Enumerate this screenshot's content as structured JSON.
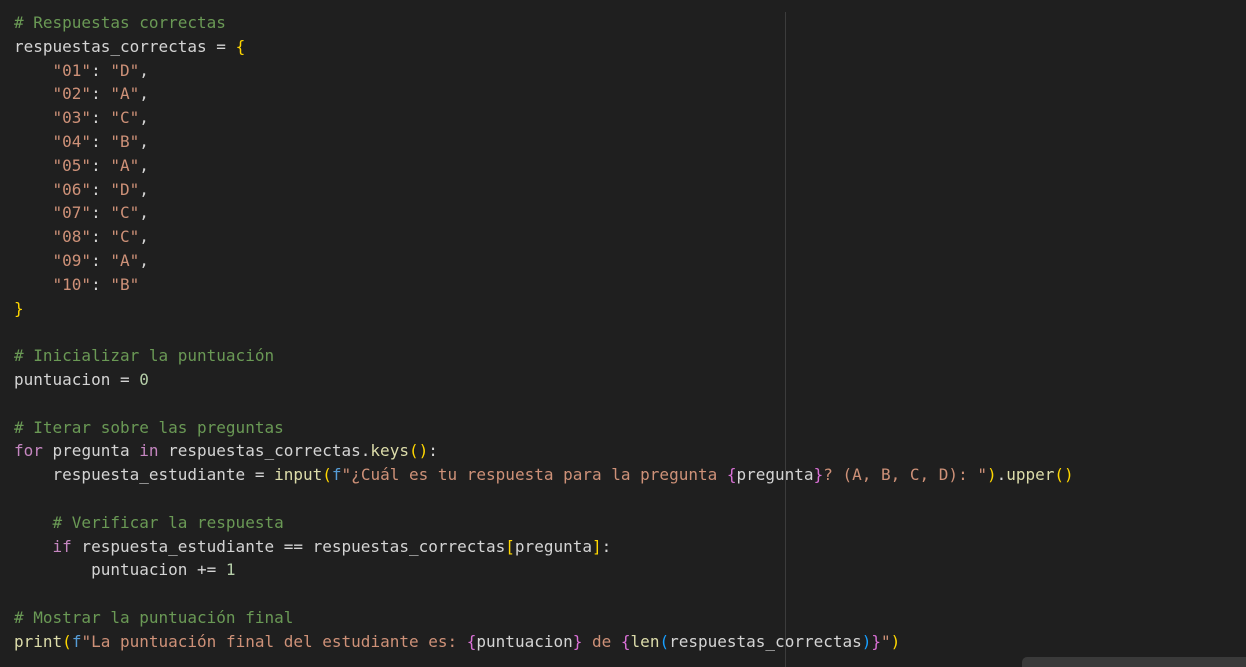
{
  "editor": {
    "lines": [
      [
        {
          "t": "# Respuestas correctas",
          "c": "comment"
        }
      ],
      [
        {
          "t": "respuestas_correctas",
          "c": "id"
        },
        {
          "t": " = ",
          "c": "op"
        },
        {
          "t": "{",
          "c": "b1"
        }
      ],
      [
        {
          "t": "    ",
          "c": "id"
        },
        {
          "t": "\"01\"",
          "c": "str"
        },
        {
          "t": ": ",
          "c": "op"
        },
        {
          "t": "\"D\"",
          "c": "str"
        },
        {
          "t": ",",
          "c": "op"
        }
      ],
      [
        {
          "t": "    ",
          "c": "id"
        },
        {
          "t": "\"02\"",
          "c": "str"
        },
        {
          "t": ": ",
          "c": "op"
        },
        {
          "t": "\"A\"",
          "c": "str"
        },
        {
          "t": ",",
          "c": "op"
        }
      ],
      [
        {
          "t": "    ",
          "c": "id"
        },
        {
          "t": "\"03\"",
          "c": "str"
        },
        {
          "t": ": ",
          "c": "op"
        },
        {
          "t": "\"C\"",
          "c": "str"
        },
        {
          "t": ",",
          "c": "op"
        }
      ],
      [
        {
          "t": "    ",
          "c": "id"
        },
        {
          "t": "\"04\"",
          "c": "str"
        },
        {
          "t": ": ",
          "c": "op"
        },
        {
          "t": "\"B\"",
          "c": "str"
        },
        {
          "t": ",",
          "c": "op"
        }
      ],
      [
        {
          "t": "    ",
          "c": "id"
        },
        {
          "t": "\"05\"",
          "c": "str"
        },
        {
          "t": ": ",
          "c": "op"
        },
        {
          "t": "\"A\"",
          "c": "str"
        },
        {
          "t": ",",
          "c": "op"
        }
      ],
      [
        {
          "t": "    ",
          "c": "id"
        },
        {
          "t": "\"06\"",
          "c": "str"
        },
        {
          "t": ": ",
          "c": "op"
        },
        {
          "t": "\"D\"",
          "c": "str"
        },
        {
          "t": ",",
          "c": "op"
        }
      ],
      [
        {
          "t": "    ",
          "c": "id"
        },
        {
          "t": "\"07\"",
          "c": "str"
        },
        {
          "t": ": ",
          "c": "op"
        },
        {
          "t": "\"C\"",
          "c": "str"
        },
        {
          "t": ",",
          "c": "op"
        }
      ],
      [
        {
          "t": "    ",
          "c": "id"
        },
        {
          "t": "\"08\"",
          "c": "str"
        },
        {
          "t": ": ",
          "c": "op"
        },
        {
          "t": "\"C\"",
          "c": "str"
        },
        {
          "t": ",",
          "c": "op"
        }
      ],
      [
        {
          "t": "    ",
          "c": "id"
        },
        {
          "t": "\"09\"",
          "c": "str"
        },
        {
          "t": ": ",
          "c": "op"
        },
        {
          "t": "\"A\"",
          "c": "str"
        },
        {
          "t": ",",
          "c": "op"
        }
      ],
      [
        {
          "t": "    ",
          "c": "id"
        },
        {
          "t": "\"10\"",
          "c": "str"
        },
        {
          "t": ": ",
          "c": "op"
        },
        {
          "t": "\"B\"",
          "c": "str"
        }
      ],
      [
        {
          "t": "}",
          "c": "b1"
        }
      ],
      [],
      [
        {
          "t": "# Inicializar la puntuación",
          "c": "comment"
        }
      ],
      [
        {
          "t": "puntuacion",
          "c": "id"
        },
        {
          "t": " = ",
          "c": "op"
        },
        {
          "t": "0",
          "c": "num"
        }
      ],
      [],
      [
        {
          "t": "# Iterar sobre las preguntas",
          "c": "comment"
        }
      ],
      [
        {
          "t": "for",
          "c": "ctrl"
        },
        {
          "t": " pregunta ",
          "c": "id"
        },
        {
          "t": "in",
          "c": "ctrl"
        },
        {
          "t": " respuestas_correctas.",
          "c": "id"
        },
        {
          "t": "keys",
          "c": "fn"
        },
        {
          "t": "()",
          "c": "b1"
        },
        {
          "t": ":",
          "c": "op"
        }
      ],
      [
        {
          "t": "    respuesta_estudiante",
          "c": "id"
        },
        {
          "t": " = ",
          "c": "op"
        },
        {
          "t": "input",
          "c": "fn"
        },
        {
          "t": "(",
          "c": "b1"
        },
        {
          "t": "f",
          "c": "kw"
        },
        {
          "t": "\"¿Cuál es tu respuesta para la pregunta ",
          "c": "str"
        },
        {
          "t": "{",
          "c": "b2"
        },
        {
          "t": "pregunta",
          "c": "id"
        },
        {
          "t": "}",
          "c": "b2"
        },
        {
          "t": "? (A, B, C, D): \"",
          "c": "str"
        },
        {
          "t": ")",
          "c": "b1"
        },
        {
          "t": ".",
          "c": "op"
        },
        {
          "t": "upper",
          "c": "fn"
        },
        {
          "t": "()",
          "c": "b1"
        }
      ],
      [],
      [
        {
          "t": "    ",
          "c": "id"
        },
        {
          "t": "# Verificar la respuesta",
          "c": "comment"
        }
      ],
      [
        {
          "t": "    ",
          "c": "id"
        },
        {
          "t": "if",
          "c": "ctrl"
        },
        {
          "t": " respuesta_estudiante ",
          "c": "id"
        },
        {
          "t": "==",
          "c": "op"
        },
        {
          "t": " respuestas_correctas",
          "c": "id"
        },
        {
          "t": "[",
          "c": "b1"
        },
        {
          "t": "pregunta",
          "c": "id"
        },
        {
          "t": "]",
          "c": "b1"
        },
        {
          "t": ":",
          "c": "op"
        }
      ],
      [
        {
          "t": "        puntuacion",
          "c": "id"
        },
        {
          "t": " += ",
          "c": "op"
        },
        {
          "t": "1",
          "c": "num"
        }
      ],
      [],
      [
        {
          "t": "# Mostrar la puntuación final",
          "c": "comment"
        }
      ],
      [
        {
          "t": "print",
          "c": "fn"
        },
        {
          "t": "(",
          "c": "b1"
        },
        {
          "t": "f",
          "c": "kw"
        },
        {
          "t": "\"La puntuación final del estudiante es: ",
          "c": "str"
        },
        {
          "t": "{",
          "c": "b2"
        },
        {
          "t": "puntuacion",
          "c": "id"
        },
        {
          "t": "}",
          "c": "b2"
        },
        {
          "t": " de ",
          "c": "str"
        },
        {
          "t": "{",
          "c": "b2"
        },
        {
          "t": "len",
          "c": "fn"
        },
        {
          "t": "(",
          "c": "b3"
        },
        {
          "t": "respuestas_correctas",
          "c": "id"
        },
        {
          "t": ")",
          "c": "b3"
        },
        {
          "t": "}",
          "c": "b2"
        },
        {
          "t": "\"",
          "c": "str"
        },
        {
          "t": ")",
          "c": "b1"
        }
      ]
    ]
  }
}
